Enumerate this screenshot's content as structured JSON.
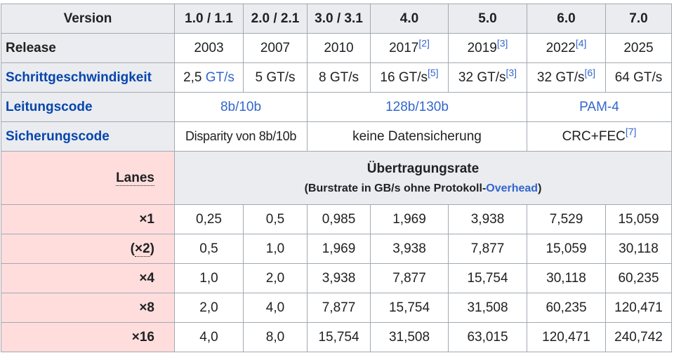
{
  "header": {
    "label": "Version",
    "versions": [
      "1.0 / 1.1",
      "2.0 / 2.1",
      "3.0 / 3.1",
      "4.0",
      "5.0",
      "6.0",
      "7.0"
    ]
  },
  "release": {
    "label": "Release",
    "years": [
      "2003",
      "2007",
      "2010",
      "2017",
      "2019",
      "2022",
      "2025"
    ],
    "refs": [
      "",
      "",
      "",
      "[2]",
      "[3]",
      "[4]",
      ""
    ]
  },
  "speed": {
    "label": "Schrittgeschwindigkeit",
    "values": [
      "2,5",
      "5 GT/s",
      "8 GT/s",
      "16 GT/s",
      "32 GT/s",
      "32 GT/s",
      "64 GT/s"
    ],
    "first_unit_link": "GT/s",
    "refs": [
      "",
      "",
      "",
      "[5]",
      "[3]",
      "[6]",
      ""
    ]
  },
  "line_code": {
    "label": "Leitungscode",
    "groups": [
      "8b/10b",
      "128b/130b",
      "PAM-4"
    ]
  },
  "safety_code": {
    "label": "Sicherungscode",
    "groups": [
      "Disparity von 8b/10b",
      "keine Datensicherung",
      "CRC+FEC"
    ],
    "ref_last": "[7]"
  },
  "transfer": {
    "lanes_label": "Lanes",
    "title": "Übertragungsrate",
    "subtitle_pre": "(Burstrate in GB/s ohne Protokoll-",
    "subtitle_link": "Overhead",
    "subtitle_post": ")"
  },
  "lanes": [
    {
      "lane": "×1",
      "values": [
        "0,25",
        "0,5",
        "0,985",
        "1,969",
        "3,938",
        "7,529",
        "15,059"
      ]
    },
    {
      "lane_pre": "(",
      "lane_abbr": "×2",
      "lane_post": ")",
      "values": [
        "0,5",
        "1,0",
        "1,969",
        "3,938",
        "7,877",
        "15,059",
        "30,118"
      ]
    },
    {
      "lane": "×4",
      "values": [
        "1,0",
        "2,0",
        "3,938",
        "7,877",
        "15,754",
        "30,118",
        "60,235"
      ]
    },
    {
      "lane": "×8",
      "values": [
        "2,0",
        "4,0",
        "7,877",
        "15,754",
        "31,508",
        "60,235",
        "120,471"
      ]
    },
    {
      "lane": "×16",
      "values": [
        "4,0",
        "8,0",
        "15,754",
        "31,508",
        "63,015",
        "120,471",
        "240,742"
      ]
    }
  ]
}
